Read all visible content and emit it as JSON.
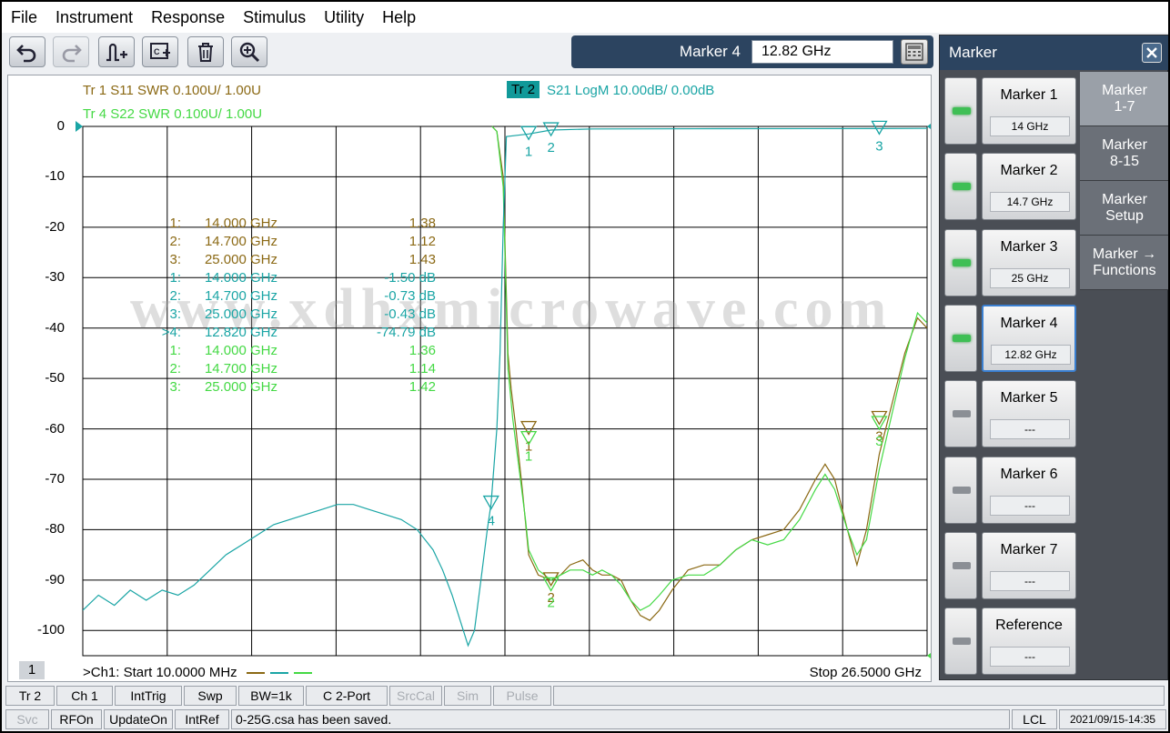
{
  "menu": [
    "File",
    "Instrument",
    "Response",
    "Stimulus",
    "Utility",
    "Help"
  ],
  "marker_entry": {
    "label": "Marker 4",
    "value": "12.82 GHz"
  },
  "traces": {
    "tr1": "Tr 1  S11 SWR 0.100U/  1.00U",
    "tr4": "Tr 4  S22 SWR 0.100U/  1.00U",
    "tr2_badge": "Tr 2",
    "tr2": "S21 LogM 10.00dB/  0.00dB"
  },
  "y_ticks": [
    "0",
    "-10",
    "-20",
    "-30",
    "-40",
    "-50",
    "-60",
    "-70",
    "-80",
    "-90",
    "-100"
  ],
  "watermark": "www.xdhxmicrowave.com",
  "marker_table": [
    {
      "idx": "1:",
      "freq": "14.000  GHz",
      "val": "1.38",
      "color": "#8b6914"
    },
    {
      "idx": "2:",
      "freq": "14.700  GHz",
      "val": "1.12",
      "color": "#8b6914"
    },
    {
      "idx": "3:",
      "freq": "25.000  GHz",
      "val": "1.43",
      "color": "#8b6914"
    },
    {
      "idx": "1:",
      "freq": "14.000  GHz",
      "val": "-1.50 dB",
      "color": "#1aa5a5"
    },
    {
      "idx": "2:",
      "freq": "14.700  GHz",
      "val": "-0.73 dB",
      "color": "#1aa5a5"
    },
    {
      "idx": "3:",
      "freq": "25.000  GHz",
      "val": "-0.43 dB",
      "color": "#1aa5a5"
    },
    {
      "idx": ">4:",
      "freq": "12.820  GHz",
      "val": "-74.79 dB",
      "color": "#1aa5a5"
    },
    {
      "idx": "1:",
      "freq": "14.000  GHz",
      "val": "1.36",
      "color": "#44d944"
    },
    {
      "idx": "2:",
      "freq": "14.700  GHz",
      "val": "1.14",
      "color": "#44d944"
    },
    {
      "idx": "3:",
      "freq": "25.000  GHz",
      "val": "1.42",
      "color": "#44d944"
    }
  ],
  "footer": {
    "channel": "1",
    "start": ">Ch1:  Start  10.0000 MHz",
    "stop": "Stop  26.5000 GHz"
  },
  "marker_panel": {
    "title": "Marker",
    "markers": [
      {
        "label": "Marker 1",
        "value": "14 GHz",
        "on": true
      },
      {
        "label": "Marker 2",
        "value": "14.7 GHz",
        "on": true
      },
      {
        "label": "Marker 3",
        "value": "25 GHz",
        "on": true
      },
      {
        "label": "Marker 4",
        "value": "12.82 GHz",
        "on": true
      },
      {
        "label": "Marker 5",
        "value": "---",
        "on": false
      },
      {
        "label": "Marker 6",
        "value": "---",
        "on": false
      },
      {
        "label": "Marker 7",
        "value": "---",
        "on": false
      },
      {
        "label": "Reference",
        "value": "---",
        "on": false
      }
    ],
    "tabs": [
      "Marker\n1-7",
      "Marker\n8-15",
      "Marker\nSetup",
      "Marker →\nFunctions"
    ]
  },
  "status1": [
    "Tr 2",
    "Ch 1",
    "IntTrig",
    "Swp",
    "BW=1k",
    "C  2-Port",
    "SrcCal",
    "Sim",
    "Pulse"
  ],
  "status2": [
    "Svc",
    "RFOn",
    "UpdateOn",
    "IntRef",
    "0-25G.csa has been saved.",
    "LCL",
    "2021/09/15-14:35"
  ],
  "colors": {
    "tr1": "#8b6914",
    "tr2": "#1aa5a5",
    "tr4": "#44d944",
    "grid": "#000000"
  },
  "chart_data": {
    "type": "line",
    "x_axis": {
      "start_ghz": 0.01,
      "stop_ghz": 26.5
    },
    "ylim": [
      -105,
      0
    ],
    "y_ticks": [
      0,
      -10,
      -20,
      -30,
      -40,
      -50,
      -60,
      -70,
      -80,
      -90,
      -100
    ],
    "series": [
      {
        "name": "Tr 1",
        "points_ghz_db": [
          [
            12.85,
            0
          ],
          [
            13.0,
            -1
          ],
          [
            13.2,
            -10
          ],
          [
            13.35,
            -45
          ],
          [
            13.45,
            -52
          ],
          [
            13.6,
            -60
          ],
          [
            13.8,
            -72
          ],
          [
            14.0,
            -85
          ],
          [
            14.3,
            -89
          ],
          [
            14.7,
            -90
          ],
          [
            15.0,
            -89
          ],
          [
            15.3,
            -87
          ],
          [
            15.7,
            -86
          ],
          [
            16.0,
            -88
          ],
          [
            16.3,
            -89
          ],
          [
            16.6,
            -89
          ],
          [
            16.9,
            -90
          ],
          [
            17.2,
            -94
          ],
          [
            17.5,
            -97
          ],
          [
            17.8,
            -98
          ],
          [
            18.1,
            -96
          ],
          [
            18.5,
            -92
          ],
          [
            19.0,
            -88
          ],
          [
            19.5,
            -87
          ],
          [
            20.0,
            -87
          ],
          [
            20.5,
            -84
          ],
          [
            21.0,
            -82
          ],
          [
            21.5,
            -81
          ],
          [
            22.0,
            -80
          ],
          [
            22.5,
            -76
          ],
          [
            23.0,
            -70
          ],
          [
            23.3,
            -67
          ],
          [
            23.6,
            -70
          ],
          [
            24.0,
            -80
          ],
          [
            24.3,
            -87
          ],
          [
            24.6,
            -80
          ],
          [
            25.0,
            -65
          ],
          [
            25.4,
            -55
          ],
          [
            25.8,
            -45
          ],
          [
            26.2,
            -38
          ],
          [
            26.5,
            -40
          ]
        ]
      },
      {
        "name": "Tr 4",
        "points_ghz_db": [
          [
            12.85,
            0
          ],
          [
            13.0,
            -1
          ],
          [
            13.2,
            -12
          ],
          [
            13.35,
            -48
          ],
          [
            13.5,
            -58
          ],
          [
            13.7,
            -68
          ],
          [
            13.9,
            -78
          ],
          [
            14.0,
            -84
          ],
          [
            14.3,
            -88
          ],
          [
            14.7,
            -90
          ],
          [
            15.0,
            -89
          ],
          [
            15.3,
            -88
          ],
          [
            15.7,
            -88
          ],
          [
            16.0,
            -89
          ],
          [
            16.3,
            -88
          ],
          [
            16.6,
            -89
          ],
          [
            16.9,
            -91
          ],
          [
            17.2,
            -94
          ],
          [
            17.5,
            -96
          ],
          [
            17.8,
            -95
          ],
          [
            18.1,
            -93
          ],
          [
            18.5,
            -90
          ],
          [
            19.0,
            -89
          ],
          [
            19.5,
            -89
          ],
          [
            20.0,
            -87
          ],
          [
            20.5,
            -84
          ],
          [
            21.0,
            -82
          ],
          [
            21.5,
            -83
          ],
          [
            22.0,
            -82
          ],
          [
            22.5,
            -78
          ],
          [
            23.0,
            -72
          ],
          [
            23.3,
            -69
          ],
          [
            23.6,
            -72
          ],
          [
            24.0,
            -80
          ],
          [
            24.3,
            -85
          ],
          [
            24.6,
            -82
          ],
          [
            25.0,
            -68
          ],
          [
            25.4,
            -57
          ],
          [
            25.8,
            -46
          ],
          [
            26.2,
            -37
          ],
          [
            26.5,
            -39
          ]
        ]
      },
      {
        "name": "Tr 2",
        "points_ghz_db": [
          [
            0.01,
            -96
          ],
          [
            0.5,
            -93
          ],
          [
            1.0,
            -95
          ],
          [
            1.5,
            -92
          ],
          [
            2.0,
            -94
          ],
          [
            2.5,
            -92
          ],
          [
            3.0,
            -93
          ],
          [
            3.5,
            -91
          ],
          [
            4.0,
            -88
          ],
          [
            4.5,
            -85
          ],
          [
            5.0,
            -83
          ],
          [
            5.5,
            -81
          ],
          [
            6.0,
            -79
          ],
          [
            6.5,
            -78
          ],
          [
            7.0,
            -77
          ],
          [
            7.5,
            -76
          ],
          [
            8.0,
            -75
          ],
          [
            8.5,
            -75
          ],
          [
            9.0,
            -76
          ],
          [
            9.5,
            -77
          ],
          [
            10.0,
            -78
          ],
          [
            10.5,
            -80
          ],
          [
            11.0,
            -84
          ],
          [
            11.3,
            -88
          ],
          [
            11.6,
            -93
          ],
          [
            11.9,
            -99
          ],
          [
            12.1,
            -103
          ],
          [
            12.3,
            -100
          ],
          [
            12.5,
            -90
          ],
          [
            12.7,
            -80
          ],
          [
            12.82,
            -74.79
          ],
          [
            13.0,
            -60
          ],
          [
            13.1,
            -45
          ],
          [
            13.2,
            -20
          ],
          [
            13.3,
            -2
          ],
          [
            14.0,
            -1.5
          ],
          [
            14.7,
            -0.73
          ],
          [
            16.0,
            -0.5
          ],
          [
            20.0,
            -0.45
          ],
          [
            25.0,
            -0.43
          ],
          [
            26.5,
            -0.4
          ]
        ]
      }
    ],
    "markers": [
      {
        "trace": "Tr 2",
        "label": "1",
        "x_ghz": 14.0,
        "y_db": -1.5
      },
      {
        "trace": "Tr 2",
        "label": "2",
        "x_ghz": 14.7,
        "y_db": -0.73
      },
      {
        "trace": "Tr 2",
        "label": "3",
        "x_ghz": 25.0,
        "y_db": -0.43
      },
      {
        "trace": "Tr 2",
        "label": "4",
        "x_ghz": 12.82,
        "y_db": -74.79
      },
      {
        "trace": "Tr 1",
        "label": "1",
        "x_ghz": 14.0,
        "y_db": -60
      },
      {
        "trace": "Tr 1",
        "label": "2",
        "x_ghz": 14.7,
        "y_db": -90
      },
      {
        "trace": "Tr 1",
        "label": "3",
        "x_ghz": 25.0,
        "y_db": -58
      },
      {
        "trace": "Tr 4",
        "label": "1",
        "x_ghz": 14.0,
        "y_db": -62
      },
      {
        "trace": "Tr 4",
        "label": "2",
        "x_ghz": 14.7,
        "y_db": -91
      },
      {
        "trace": "Tr 4",
        "label": "3",
        "x_ghz": 25.0,
        "y_db": -59
      }
    ]
  }
}
